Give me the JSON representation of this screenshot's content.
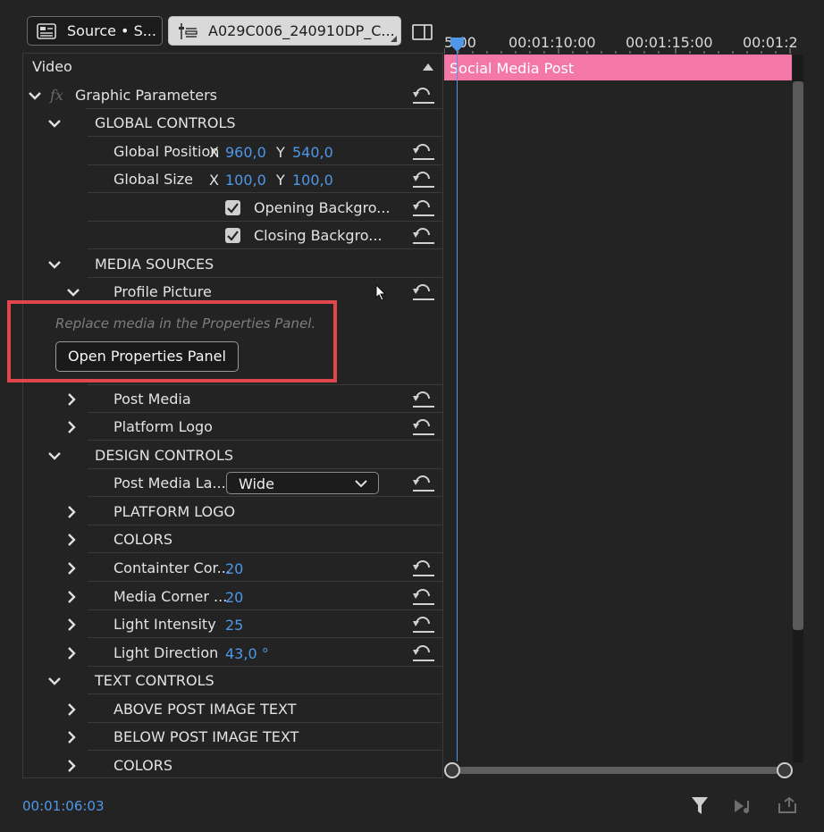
{
  "tabs": {
    "source_label": "Source • S...",
    "clip_label": "A029C006_240910DP_C..."
  },
  "panel": {
    "section_title": "Video",
    "rows": {
      "graphic_parameters": "Graphic Parameters",
      "global_controls": "GLOBAL CONTROLS",
      "global_position": {
        "label": "Global Position",
        "x_label": "X",
        "x": "960,0",
        "y_label": "Y",
        "y": "540,0"
      },
      "global_size": {
        "label": "Global Size",
        "x_label": "X",
        "x": "100,0",
        "y_label": "Y",
        "y": "100,0"
      },
      "opening_background": "Opening Backgro...",
      "closing_background": "Closing Backgro...",
      "media_sources": "MEDIA SOURCES",
      "profile_picture": "Profile Picture",
      "replace_hint": "Replace media in the Properties Panel.",
      "open_properties_button": "Open Properties Panel",
      "post_media": "Post Media",
      "platform_logo": "Platform Logo",
      "design_controls": "DESIGN CONTROLS",
      "post_media_layout": {
        "label": "Post Media La...",
        "selected": "Wide"
      },
      "platform_logo_group": "PLATFORM LOGO",
      "colors": "COLORS",
      "container_corner": {
        "label": "Containter Cor...",
        "value": "20"
      },
      "media_corner": {
        "label": "Media Corner ...",
        "value": "20"
      },
      "light_intensity": {
        "label": "Light Intensity",
        "value": "25"
      },
      "light_direction": {
        "label": "Light Direction",
        "value": "43,0 °"
      },
      "text_controls": "TEXT CONTROLS",
      "above_post_image_text": "ABOVE POST IMAGE TEXT",
      "below_post_image_text": "BELOW POST IMAGE TEXT",
      "colors_text": "COLORS"
    }
  },
  "timeline": {
    "ticks": [
      "5:00",
      "00:01:10:00",
      "00:01:15:00",
      "00:01:2"
    ],
    "clip_name": "Social Media Post"
  },
  "footer": {
    "timecode": "00:01:06:03"
  },
  "colors": {
    "accent_blue": "#4f97e8",
    "clip_pink": "#f478a7",
    "highlight_red": "#e0474c"
  }
}
